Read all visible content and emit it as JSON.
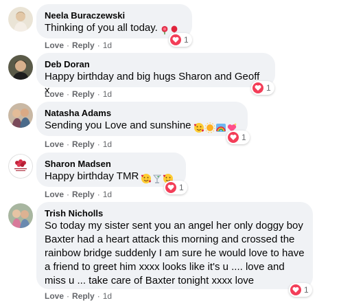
{
  "comments": [
    {
      "author": "Neela Buraczewski",
      "text": "Thinking of you all today.",
      "reaction_count": "1",
      "like_label": "Love",
      "reply_label": "Reply",
      "time": "1d",
      "emojis": [
        "rose-emoji",
        "red-balloon-emoji"
      ]
    },
    {
      "author": "Deb Doran",
      "text": "Happy birthday and big hugs Sharon and Geoff x",
      "reaction_count": "1",
      "like_label": "Love",
      "reply_label": "Reply",
      "time": "1d",
      "emojis": []
    },
    {
      "author": "Natasha Adams",
      "text": "Sending you Love and sunshine",
      "reaction_count": "1",
      "like_label": "Love",
      "reply_label": "Reply",
      "time": "1d",
      "emojis": [
        "smiling-face-with-hearts-emoji",
        "sun-emoji",
        "rainbow-emoji",
        "sparkling-heart-emoji"
      ]
    },
    {
      "author": "Sharon Madsen",
      "text": "Happy birthday TMR",
      "reaction_count": "1",
      "like_label": "Love",
      "reply_label": "Reply",
      "time": "1d",
      "emojis": [
        "smiling-face-with-hearts-emoji",
        "cocktail-glass-emoji",
        "smiling-face-with-hearts-emoji"
      ]
    },
    {
      "author": "Trish Nicholls",
      "text_lines": [
        "So today my sister sent you an angel her only doggy boy",
        "Baxter had a heart attack this morning and crossed the",
        "rainbow bridge suddenly I am sure he would love to have",
        "a friend to greet him xxxx looks like it's u .... love and",
        "miss u ... take care of Baxter tonight xxxx love"
      ],
      "reaction_count": "1",
      "like_label": "Love",
      "reply_label": "Reply",
      "time": "1d",
      "emojis": []
    }
  ],
  "colors": {
    "bubble": "#f0f2f5",
    "love_red": "#f33e58",
    "meta_grey": "#65676b",
    "text": "#050505"
  }
}
